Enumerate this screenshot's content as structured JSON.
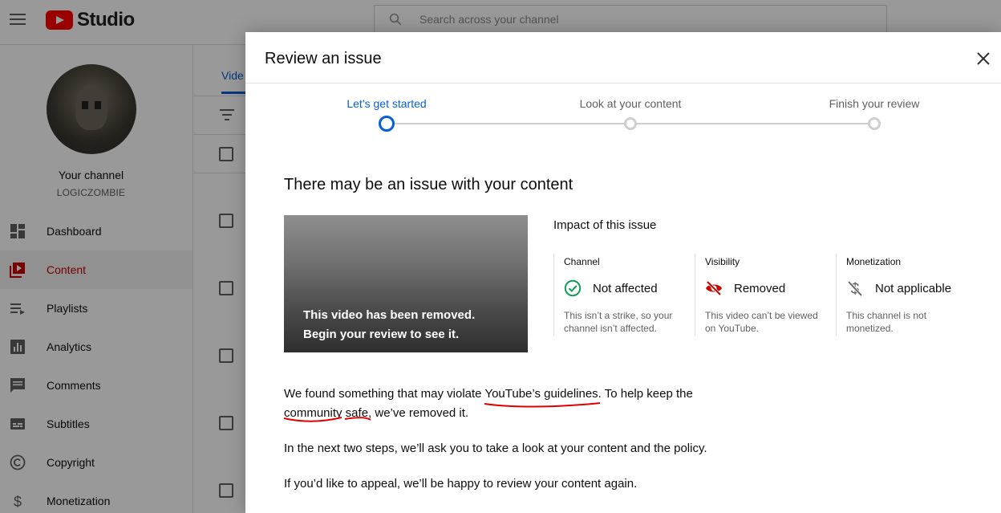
{
  "app": {
    "name": "Studio"
  },
  "search": {
    "placeholder": "Search across your channel"
  },
  "sidebar": {
    "channel_title": "Your channel",
    "channel_handle": "LOGICZOMBIE",
    "items": [
      {
        "label": "Dashboard",
        "icon": "dashboard-icon"
      },
      {
        "label": "Content",
        "icon": "content-icon",
        "active": true
      },
      {
        "label": "Playlists",
        "icon": "playlists-icon"
      },
      {
        "label": "Analytics",
        "icon": "analytics-icon"
      },
      {
        "label": "Comments",
        "icon": "comments-icon"
      },
      {
        "label": "Subtitles",
        "icon": "subtitles-icon"
      },
      {
        "label": "Copyright",
        "icon": "copyright-icon"
      },
      {
        "label": "Monetization",
        "icon": "monetization-icon"
      }
    ]
  },
  "content_bg": {
    "tab_label": "Vide"
  },
  "dialog": {
    "title": "Review an issue",
    "steps": [
      {
        "label": "Let’s get started",
        "active": true
      },
      {
        "label": "Look at your content",
        "active": false
      },
      {
        "label": "Finish your review",
        "active": false
      }
    ],
    "heading": "There may be an issue with your content",
    "thumbnail": {
      "line1": "This video has been removed.",
      "line2": "Begin your review to see it."
    },
    "impact": {
      "title": "Impact of this issue",
      "columns": [
        {
          "head": "Channel",
          "status": "Not affected",
          "icon": "check-circle-icon",
          "desc1": "This isn’t a strike, so your",
          "desc2": "channel isn’t affected."
        },
        {
          "head": "Visibility",
          "status": "Removed",
          "icon": "eye-off-icon",
          "desc1": "This video can’t be viewed",
          "desc2": "on YouTube."
        },
        {
          "head": "Monetization",
          "status": "Not applicable",
          "icon": "dollar-off-icon",
          "desc1": "This channel is not",
          "desc2": "monetized."
        }
      ]
    },
    "body": {
      "p1_a": "We found something that may violate ",
      "p1_link": "YouTube’s guidelines",
      "p1_b": ". To help keep the",
      "p1_c": "community safe, we’ve removed it.",
      "p2": "In the next two steps, we’ll ask you to take a look at your content and the policy.",
      "p3": "If you’d like to appeal, we’ll be happy to review your content again."
    }
  },
  "colors": {
    "accent_blue": "#065fd4",
    "brand_red": "#ff0000",
    "active_red": "#cc0000",
    "check_green": "#0f9d58",
    "removed_red": "#cc0000",
    "annotation_red": "#e00000"
  }
}
